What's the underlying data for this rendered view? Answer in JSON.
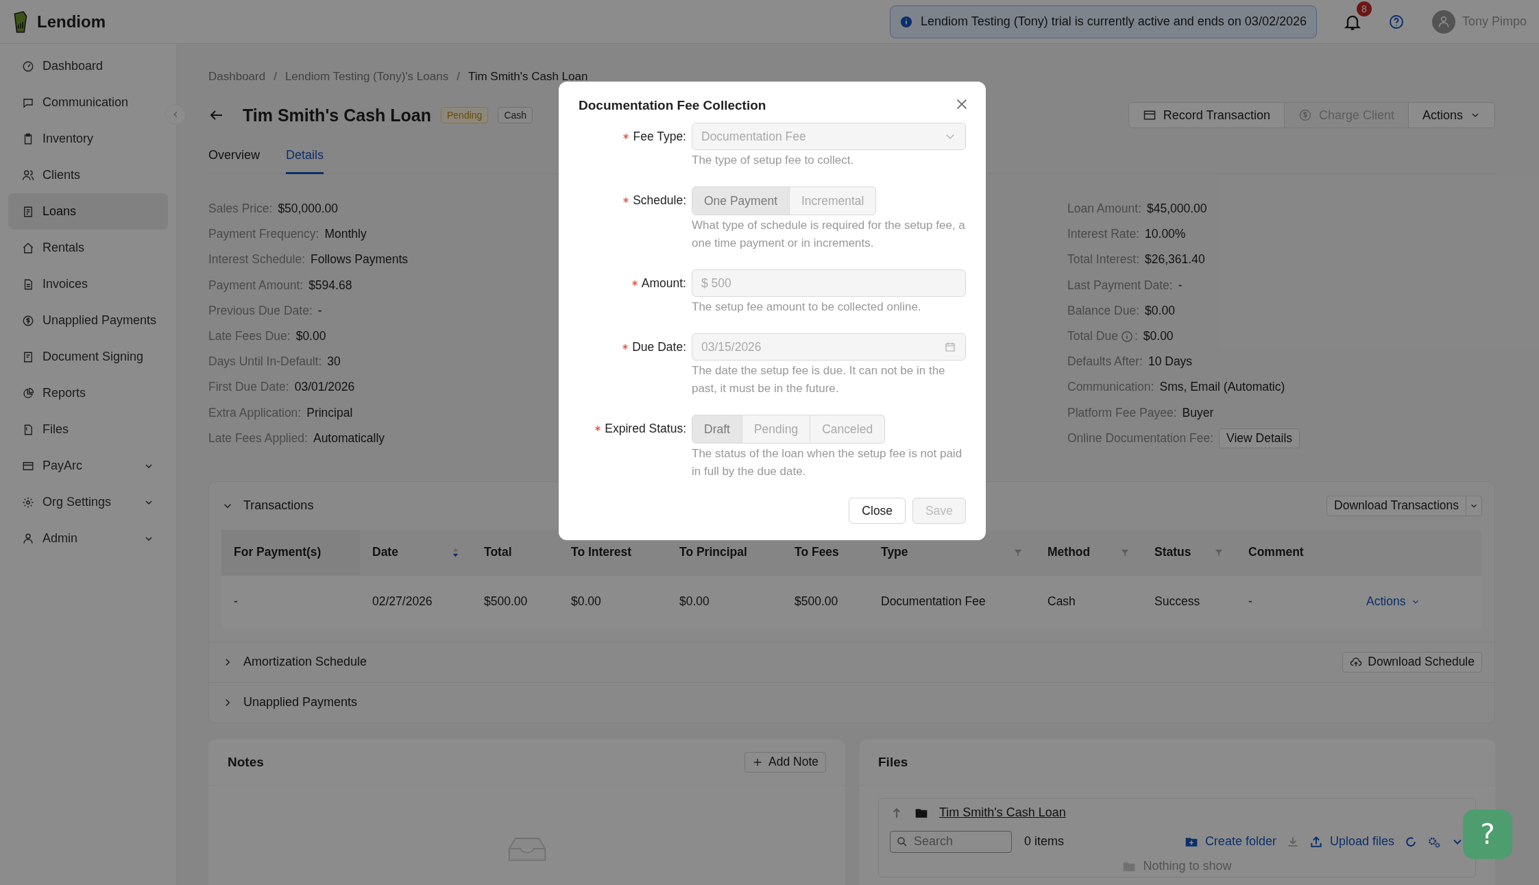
{
  "app": {
    "name": "Lendiom"
  },
  "banner": {
    "text": "Lendiom Testing (Tony) trial is currently active and ends on 03/02/2026"
  },
  "notifications": {
    "count": "8"
  },
  "user": {
    "name": "Tony Pimpo"
  },
  "sidebar": {
    "items": [
      {
        "label": "Dashboard",
        "selected": false,
        "expandable": false
      },
      {
        "label": "Communication",
        "selected": false,
        "expandable": false
      },
      {
        "label": "Inventory",
        "selected": false,
        "expandable": false
      },
      {
        "label": "Clients",
        "selected": false,
        "expandable": false
      },
      {
        "label": "Loans",
        "selected": true,
        "expandable": false
      },
      {
        "label": "Rentals",
        "selected": false,
        "expandable": false
      },
      {
        "label": "Invoices",
        "selected": false,
        "expandable": false
      },
      {
        "label": "Unapplied Payments",
        "selected": false,
        "expandable": false
      },
      {
        "label": "Document Signing",
        "selected": false,
        "expandable": false
      },
      {
        "label": "Reports",
        "selected": false,
        "expandable": false
      },
      {
        "label": "Files",
        "selected": false,
        "expandable": false
      },
      {
        "label": "PayArc",
        "selected": false,
        "expandable": true
      },
      {
        "label": "Org Settings",
        "selected": false,
        "expandable": true
      },
      {
        "label": "Admin",
        "selected": false,
        "expandable": true
      }
    ]
  },
  "breadcrumb": {
    "separator": "/",
    "items": [
      "Dashboard",
      "Lendiom Testing (Tony)'s Loans",
      "Tim Smith's Cash Loan"
    ]
  },
  "page": {
    "title": "Tim Smith's Cash Loan",
    "tags": [
      {
        "label": "Pending",
        "kind": "warning"
      },
      {
        "label": "Cash",
        "kind": "default"
      }
    ]
  },
  "header_actions": [
    {
      "label": "Record Transaction",
      "kind": "card",
      "disabled": false
    },
    {
      "label": "Charge Client",
      "kind": "dollar",
      "disabled": true
    },
    {
      "label": "Actions",
      "kind": "dropdown",
      "disabled": false
    }
  ],
  "tabs": [
    {
      "label": "Overview",
      "selected": false
    },
    {
      "label": "Details",
      "selected": true
    }
  ],
  "details_left": [
    {
      "label": "Sales Price:",
      "value": "$50,000.00"
    },
    {
      "label": "Payment Frequency:",
      "value": "Monthly"
    },
    {
      "label": "Interest Schedule:",
      "value": "Follows Payments"
    },
    {
      "label": "Payment Amount:",
      "value": "$594.68"
    },
    {
      "label": "Previous Due Date:",
      "value": "-"
    },
    {
      "label": "Late Fees Due:",
      "value": "$0.00"
    },
    {
      "label": "Days Until In-Default:",
      "value": "30"
    },
    {
      "label": "First Due Date:",
      "value": "03/01/2026"
    },
    {
      "label": "Extra Application:",
      "value": "Principal"
    },
    {
      "label": "Late Fees Applied:",
      "value": "Automatically"
    }
  ],
  "details_right": [
    {
      "label": "Loan Amount:",
      "value": "$45,000.00",
      "kind": "text"
    },
    {
      "label": "Interest Rate:",
      "value": "10.00%",
      "kind": "text"
    },
    {
      "label": "Total Interest:",
      "value": "$26,361.40",
      "kind": "text"
    },
    {
      "label": "Last Payment Date:",
      "value": "-",
      "kind": "text"
    },
    {
      "label": "Balance Due:",
      "value": "$0.00",
      "kind": "text"
    },
    {
      "label": "Total Due",
      "after_icon": ":",
      "value": "$0.00",
      "kind": "info"
    },
    {
      "label": "Defaults After:",
      "value": "10 Days",
      "kind": "text"
    },
    {
      "label": "Communication:",
      "value": "Sms, Email (Automatic)",
      "kind": "text"
    },
    {
      "label": "Platform Fee Payee:",
      "value": "Buyer",
      "kind": "text"
    },
    {
      "label": "Online Documentation Fee:",
      "value": "View Details",
      "kind": "button"
    }
  ],
  "transactions": {
    "title": "Transactions",
    "expanded": true,
    "download_button": "Download Transactions",
    "columns": [
      {
        "label": "For Payment(s)",
        "sort": false,
        "filter": false
      },
      {
        "label": "Date",
        "sort": true,
        "filter": false
      },
      {
        "label": "Total",
        "sort": false,
        "filter": false
      },
      {
        "label": "To Interest",
        "sort": false,
        "filter": false
      },
      {
        "label": "To Principal",
        "sort": false,
        "filter": false
      },
      {
        "label": "To Fees",
        "sort": false,
        "filter": false
      },
      {
        "label": "Type",
        "sort": false,
        "filter": true
      },
      {
        "label": "Method",
        "sort": false,
        "filter": true
      },
      {
        "label": "Status",
        "sort": false,
        "filter": true
      },
      {
        "label": "Comment",
        "sort": false,
        "filter": false
      }
    ],
    "rows": [
      {
        "cells": [
          "-",
          "02/27/2026",
          "$500.00",
          "$0.00",
          "$0.00",
          "$500.00",
          "Documentation Fee",
          "Cash",
          "Success",
          "-"
        ],
        "action": "Actions"
      }
    ]
  },
  "sections": [
    {
      "title": "Amortization Schedule",
      "expanded": false,
      "button": "Download Schedule"
    },
    {
      "title": "Unapplied Payments",
      "expanded": false
    }
  ],
  "notes": {
    "title": "Notes",
    "add_button": "Add Note"
  },
  "files": {
    "title": "Files",
    "folder": "Tim Smith's Cash Loan",
    "search_placeholder": "Search",
    "count": "0 items",
    "create_folder": "Create folder",
    "upload": "Upload files",
    "empty": "Nothing to show"
  },
  "modal": {
    "title": "Documentation Fee Collection",
    "fields": [
      {
        "kind": "select",
        "label": "Fee Type:",
        "required": true,
        "disabled": true,
        "value": "Documentation Fee",
        "help": "The type of setup fee to collect."
      },
      {
        "kind": "segmented",
        "label": "Schedule:",
        "required": true,
        "disabled": true,
        "options": [
          {
            "label": "One Payment",
            "selected": true
          },
          {
            "label": "Incremental",
            "selected": false
          }
        ],
        "help": "What type of schedule is required for the setup fee, a one time payment or in increments."
      },
      {
        "kind": "input",
        "label": "Amount:",
        "required": true,
        "disabled": true,
        "prefix": "$",
        "value": "500",
        "help": "The setup fee amount to be collected online."
      },
      {
        "kind": "date",
        "label": "Due Date:",
        "required": true,
        "disabled": true,
        "value": "03/15/2026",
        "help": "The date the setup fee is due. It can not be in the past, it must be in the future."
      },
      {
        "kind": "segmented",
        "label": "Expired Status:",
        "required": true,
        "disabled": true,
        "options": [
          {
            "label": "Draft",
            "selected": true
          },
          {
            "label": "Pending",
            "selected": false
          },
          {
            "label": "Canceled",
            "selected": false
          }
        ],
        "help": "The status of the loan when the setup fee is not paid in full by the due date."
      }
    ],
    "buttons": [
      {
        "label": "Close",
        "disabled": false
      },
      {
        "label": "Save",
        "disabled": true
      }
    ]
  },
  "help_button": {
    "label": "?"
  }
}
